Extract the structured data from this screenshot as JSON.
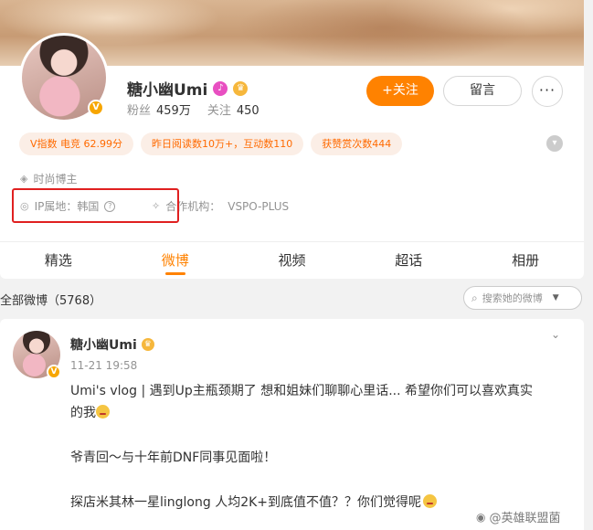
{
  "profile": {
    "username": "糖小幽Umi",
    "fans_label": "粉丝",
    "fans_count": "459万",
    "following_label": "关注",
    "following_count": "450",
    "follow_button": "+关注",
    "message_button": "留言",
    "more_button": "···",
    "vip_badge": "V"
  },
  "tags": [
    "V指数 电竞 62.99分",
    "昨日阅读数10万+，互动数110",
    "获赞赏次数444"
  ],
  "info": {
    "role": "时尚博主",
    "ip_label": "IP属地：韩国",
    "agency_label": "合作机构：",
    "agency_value": "VSPO-PLUS"
  },
  "tabs": [
    "精选",
    "微博",
    "视频",
    "超话",
    "相册"
  ],
  "active_tab": "微博",
  "list": {
    "title": "全部微博（5768）",
    "search_placeholder": "搜索她的微博"
  },
  "post": {
    "author": "糖小幽Umi",
    "time": "11-21 19:58",
    "line1": "Umi's vlog | 遇到Up主瓶颈期了 想和姐妹们聊聊心里话... 希望你们可以喜欢真实",
    "line2": "的我",
    "line3": "爷青回～与十年前DNF同事见面啦！",
    "line4": "探店米其林一星linglong  人均2K+到底值不值？？你们觉得呢"
  },
  "watermark": "@英雄联盟菌",
  "colors": {
    "accent": "#ff8200",
    "tag_bg": "#fbeee6",
    "tag_text": "#ff6a00",
    "highlight_box": "#e02020"
  },
  "icons": {
    "role": "shield-icon",
    "ip": "location-icon",
    "agency": "handshake-icon",
    "search": "search-icon"
  }
}
